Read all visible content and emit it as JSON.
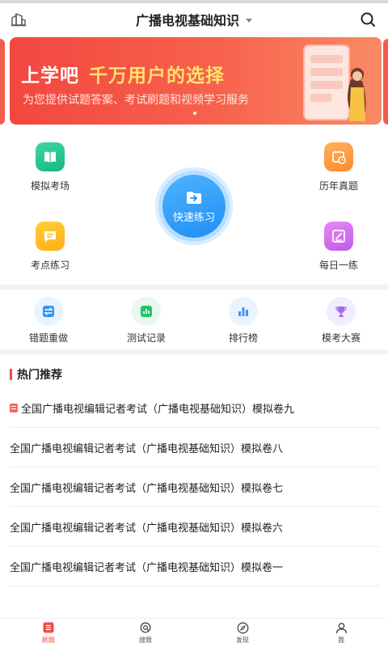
{
  "header": {
    "title": "广播电视基础知识"
  },
  "banner": {
    "headline_main": "上学吧",
    "headline_highlight": "千万用户的选择",
    "subline": "为您提供试题答案、考试刷题和视频学习服务"
  },
  "features": {
    "mock_exam": "模拟考场",
    "past_papers": "历年真题",
    "quick_practice": "快速练习",
    "topic_practice": "考点练习",
    "daily_practice": "每日一练"
  },
  "tools": {
    "redo_wrong": "错题重做",
    "test_records": "测试记录",
    "ranking": "排行榜",
    "mock_contest": "模考大赛"
  },
  "hot": {
    "title": "热门推荐",
    "items": [
      "全国广播电视编辑记者考试（广播电视基础知识）模拟卷九",
      "全国广播电视编辑记者考试（广播电视基础知识）模拟卷八",
      "全国广播电视编辑记者考试（广播电视基础知识）模拟卷七",
      "全国广播电视编辑记者考试（广播电视基础知识）模拟卷六",
      "全国广播电视编辑记者考试（广播电视基础知识）模拟卷一"
    ]
  },
  "nav": {
    "practice": "刷题",
    "search": "搜题",
    "discover": "发现",
    "me": "我"
  },
  "colors": {
    "accent_red": "#f24b3f",
    "accent_blue": "#1f8ff3"
  }
}
